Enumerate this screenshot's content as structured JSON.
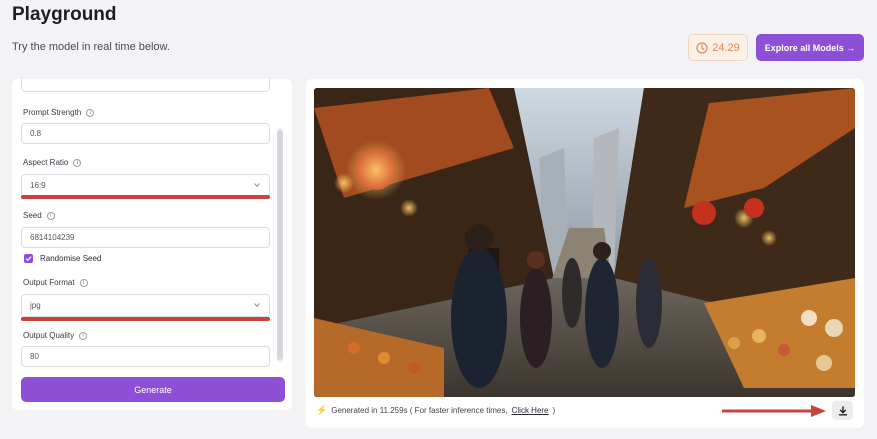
{
  "header": {
    "title": "Playground",
    "subtitle": "Try the model in real time below.",
    "credits": "24.29",
    "explore_label": "Explore all Models →"
  },
  "form": {
    "prompt_strength": {
      "label": "Prompt Strength",
      "value": "0.8"
    },
    "aspect_ratio": {
      "label": "Aspect Ratio",
      "value": "16:9"
    },
    "seed": {
      "label": "Seed",
      "value": "6814104239"
    },
    "randomise_seed": {
      "label": "Randomise Seed",
      "checked": true
    },
    "output_format": {
      "label": "Output Format",
      "value": "jpg"
    },
    "output_quality": {
      "label": "Output Quality",
      "value": "80"
    },
    "generate_label": "Generate"
  },
  "output": {
    "generated_prefix": "Generated in 11.259s ( For faster inference times,",
    "click_here": "Click Here",
    "generated_suffix": ")"
  },
  "colors": {
    "accent": "#8c4fd6",
    "annotation_red": "#c8433b",
    "credits_orange": "#e0885a"
  },
  "icons": {
    "credits": "clock-icon",
    "info": "info-icon",
    "select": "chevron-down-icon",
    "checkbox": "check-icon",
    "speed": "bolt-icon",
    "download": "download-icon"
  }
}
